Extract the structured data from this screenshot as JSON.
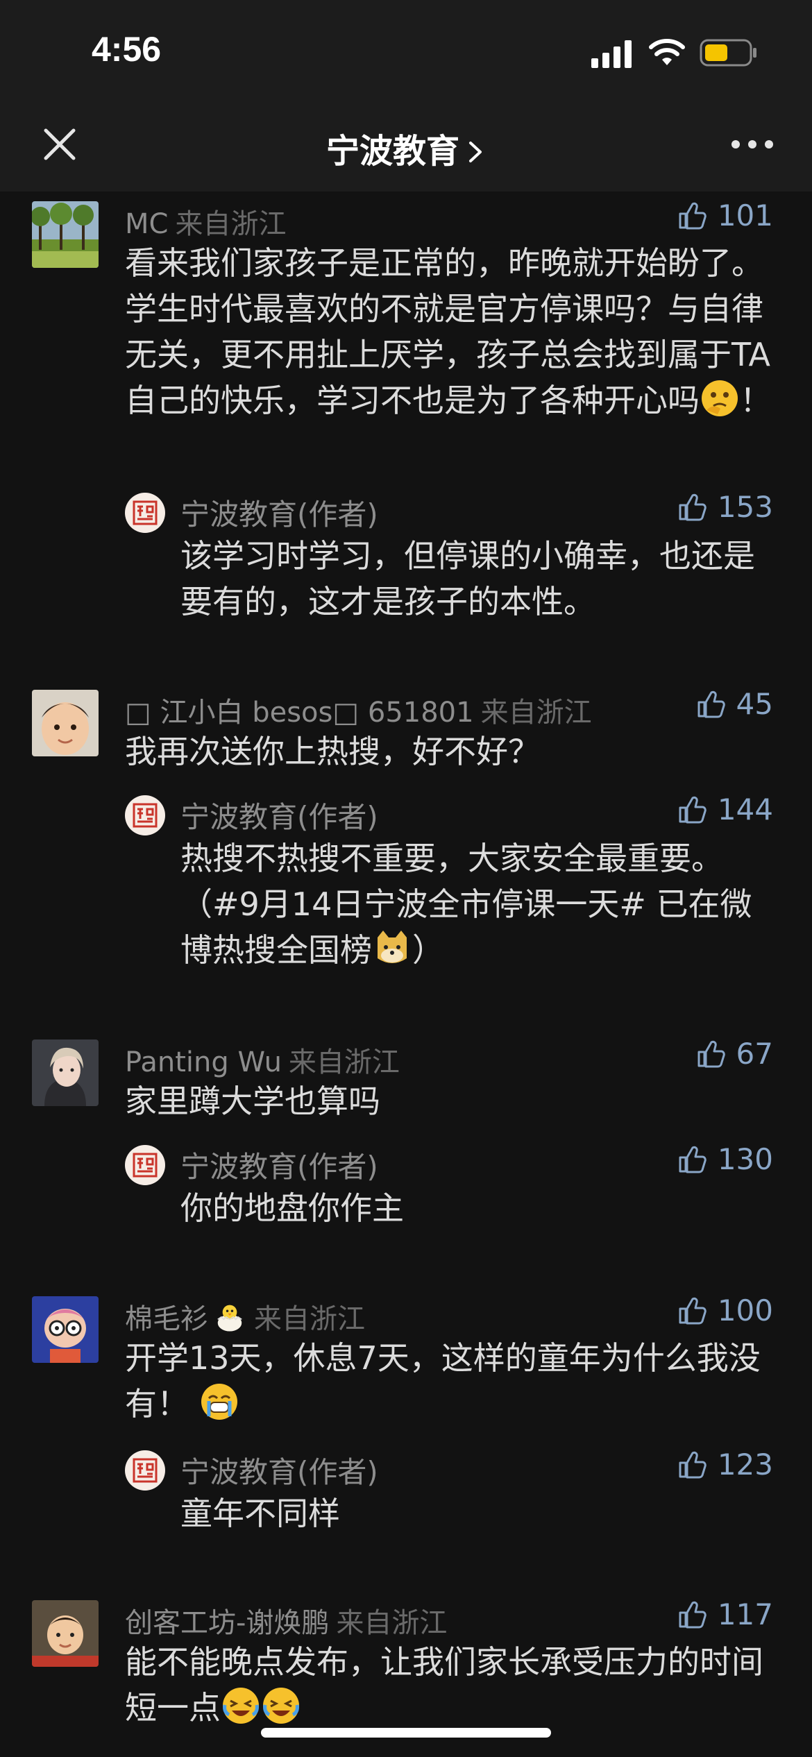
{
  "status": {
    "time": "4:56"
  },
  "nav": {
    "title": "宁波教育",
    "close_icon": "close-icon",
    "more_icon": "more-icon"
  },
  "colors": {
    "background": "#121212",
    "bar": "#1c1c1c",
    "like": "#8aa6c7",
    "author_name": "#8d8d8d"
  },
  "comments": [
    {
      "name": "MC",
      "location": "来自浙江",
      "likes": "101",
      "avatar": "trees-avatar",
      "text": "看来我们家孩子是正常的，昨晚就开始盼了。学生时代最喜欢的不就是官方停课吗？与自律无关，更不用扯上厌学，孩子总会找到属于TA自己的快乐，学习不也是为了各种开心吗",
      "text_suffix": "！",
      "emoji": "thinking-emoji",
      "reply": {
        "name": "宁波教育(作者)",
        "likes": "153",
        "text": "该学习时学习，但停课的小确幸，也还是要有的，这才是孩子的本性。"
      }
    },
    {
      "name": "□ 江小白 besos□ 651801",
      "location": "来自浙江",
      "likes": "45",
      "avatar": "child-avatar",
      "text": "我再次送你上热搜，好不好？",
      "reply": {
        "name": "宁波教育(作者)",
        "likes": "144",
        "text": "热搜不热搜不重要，大家安全最重要。（#9月14日宁波全市停课一天# 已在微博热搜全国榜",
        "text_suffix": "）",
        "emoji": "doge-emoji"
      }
    },
    {
      "name": "Panting Wu",
      "location": "来自浙江",
      "likes": "67",
      "avatar": "woman-avatar",
      "text": "家里蹲大学也算吗",
      "reply": {
        "name": "宁波教育(作者)",
        "likes": "130",
        "text": "你的地盘你作主"
      }
    },
    {
      "name": "棉毛衫",
      "location": "来自浙江",
      "likes": "100",
      "avatar": "cartoon-avatar",
      "name_emoji": "chick-emoji",
      "text": "开学13天，休息7天，这样的童年为什么我没有！",
      "emoji": "crying-emoji",
      "reply": {
        "name": "宁波教育(作者)",
        "likes": "123",
        "text": "童年不同样"
      }
    },
    {
      "name": "创客工坊-谢焕鹏",
      "location": "来自浙江",
      "likes": "117",
      "avatar": "baby-avatar",
      "text": "能不能晚点发布，让我们家长承受压力的时间短一点",
      "emoji": "laughing-tears-emoji"
    }
  ]
}
